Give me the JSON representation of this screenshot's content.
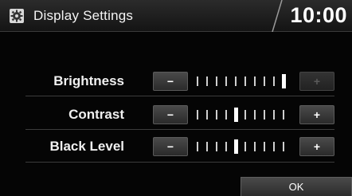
{
  "header": {
    "title": "Display Settings",
    "clock": "10:00",
    "icon": "gear-icon"
  },
  "settings": [
    {
      "label": "Brightness",
      "minus_label": "−",
      "plus_label": "+",
      "level": 10,
      "max_level": 10,
      "plus_enabled": false
    },
    {
      "label": "Contrast",
      "minus_label": "−",
      "plus_label": "+",
      "level": 5,
      "max_level": 10,
      "plus_enabled": true
    },
    {
      "label": "Black Level",
      "minus_label": "−",
      "plus_label": "+",
      "level": 5,
      "max_level": 10,
      "plus_enabled": true
    }
  ],
  "footer": {
    "ok_label": "OK"
  },
  "colors": {
    "background": "#050505",
    "header": "#1e1e1e",
    "button": "#3a3a3a",
    "text": "#f2f2f2"
  }
}
